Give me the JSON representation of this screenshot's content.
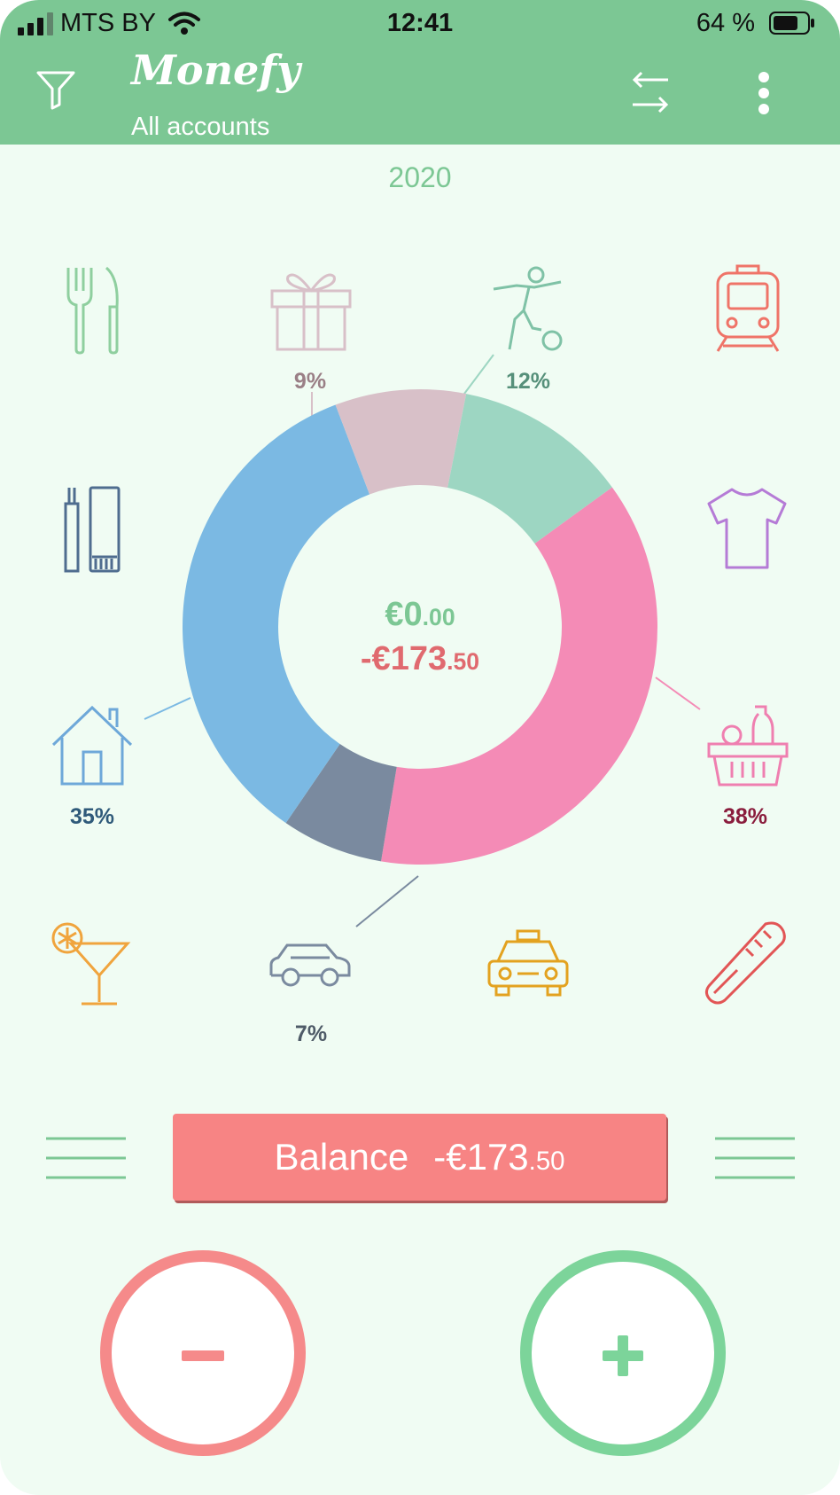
{
  "status_bar": {
    "carrier": "MTS BY",
    "time": "12:41",
    "battery": "64 %"
  },
  "header": {
    "title": "Monefy",
    "subtitle": "All accounts",
    "icons": [
      "filter-icon",
      "transfer-icon",
      "more-icon"
    ]
  },
  "period": "2020",
  "summary": {
    "income_main": "€0",
    "income_cents": ".00",
    "expense_main": "-€173",
    "expense_cents": ".50"
  },
  "categories": [
    {
      "icon": "restaurant-icon",
      "percent": ""
    },
    {
      "icon": "gift-icon",
      "percent": "9%"
    },
    {
      "icon": "sports-icon",
      "percent": "12%"
    },
    {
      "icon": "transport-icon",
      "percent": ""
    },
    {
      "icon": "toiletry-icon",
      "percent": ""
    },
    {
      "icon": "clothes-icon",
      "percent": ""
    },
    {
      "icon": "house-icon",
      "percent": "35%"
    },
    {
      "icon": "food-icon",
      "percent": "38%"
    },
    {
      "icon": "cocktail-icon",
      "percent": ""
    },
    {
      "icon": "car-icon",
      "percent": "7%"
    },
    {
      "icon": "taxi-icon",
      "percent": ""
    },
    {
      "icon": "health-icon",
      "percent": ""
    }
  ],
  "chart_data": {
    "type": "pie",
    "categories": [
      "Food",
      "Car",
      "House",
      "Gift",
      "Sports"
    ],
    "values": [
      38,
      7,
      35,
      9,
      12
    ],
    "colors": [
      "#f48bb6",
      "#7a8a9f",
      "#7bb9e3",
      "#d8c0c8",
      "#9dd6c2"
    ]
  },
  "balance": {
    "label": "Balance",
    "amount_main": "-€173",
    "amount_cents": ".50"
  },
  "actions": {
    "expense": "−",
    "income": "+"
  },
  "colors": {
    "brand": "#7cc794",
    "expense": "#f58a8a",
    "income": "#7cd49a",
    "background": "#f0fcf3"
  }
}
